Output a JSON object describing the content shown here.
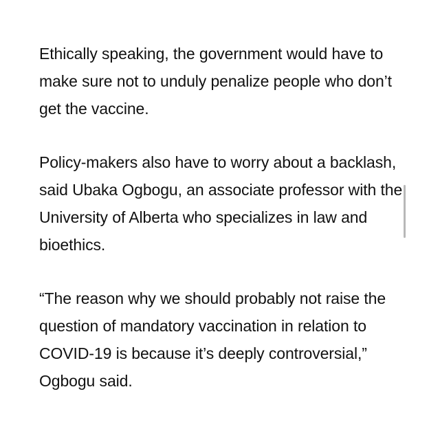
{
  "article": {
    "paragraphs": [
      "Ethically speaking, the government would have to make sure not to unduly penalize people who don’t get the vaccine.",
      "Policy-makers also have to worry about a backlash, said Ubaka Ogbogu, an associate professor with the University of Alberta who specializes in law and bioethics.",
      "“The reason why we should probably not raise the question of mandatory vaccination in relation to COVID-19 is because it’s deeply controversial,” Ogbogu said."
    ]
  }
}
